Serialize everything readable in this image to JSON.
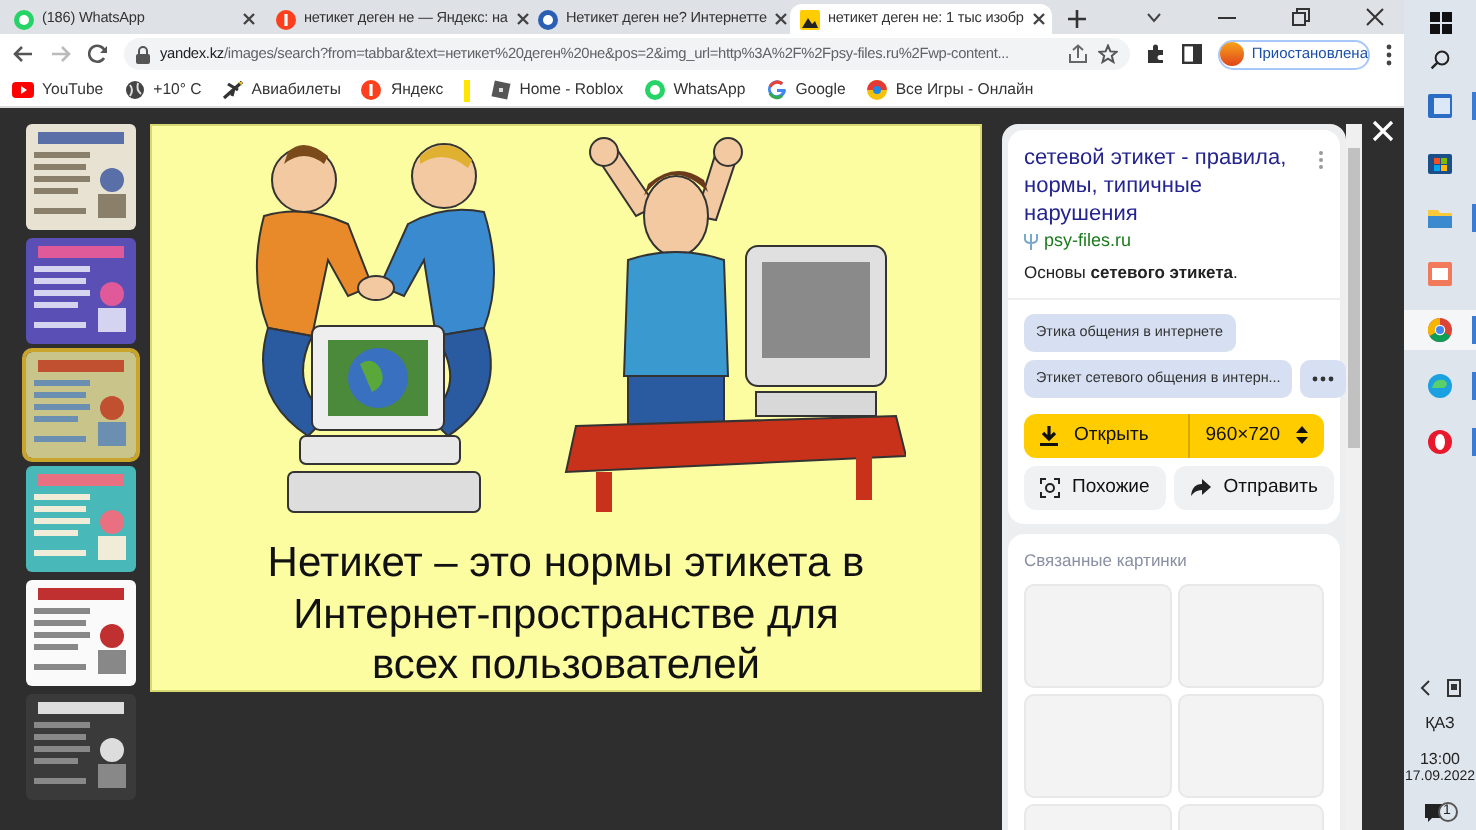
{
  "browser": {
    "tabs": [
      {
        "title": "(186) WhatsApp",
        "selected": false
      },
      {
        "title": "нетикет деген не — Яндекс: на",
        "selected": false
      },
      {
        "title": "Нетикет деген не? Интернетте",
        "selected": false
      },
      {
        "title": "нетикет деген не: 1 тыс изобр",
        "selected": true
      }
    ],
    "address": {
      "host": "yandex.kz",
      "path": "/images/search?from=tabbar&text=нетикет%20деген%20не&pos=2&img_url=http%3A%2F%2Fpsy-files.ru%2Fwp-content..."
    },
    "profile": "Приостановлена",
    "bookmarks": [
      {
        "kind": "link",
        "title": "YouTube"
      },
      {
        "kind": "link",
        "title": "+10° C"
      },
      {
        "kind": "link",
        "title": "Авиабилеты"
      },
      {
        "kind": "link",
        "title": "Яндекс"
      },
      {
        "kind": "marker"
      },
      {
        "kind": "link",
        "title": "Home - Roblox"
      },
      {
        "kind": "link",
        "title": "WhatsApp"
      },
      {
        "kind": "link",
        "title": "Google"
      },
      {
        "kind": "link",
        "title": "Все Игры - Онлайн"
      }
    ]
  },
  "viewer": {
    "thumbnails": [
      {
        "kind": "picture",
        "selected": false
      },
      {
        "kind": "picture",
        "selected": false
      },
      {
        "kind": "picture",
        "selected": true
      },
      {
        "kind": "picture",
        "selected": false
      },
      {
        "kind": "picture",
        "selected": false
      },
      {
        "kind": "picture",
        "selected": false
      }
    ],
    "slide": {
      "caption": "Нетикет – это нормы этикета в Интернет-пространстве для всех пользователей"
    },
    "info": {
      "title": "сетевой этикет - правила, нормы, типичные нарушения",
      "source": "psy-files.ru",
      "description": "Основы **сетевого этикета**.",
      "tags": [
        "Этика общения в интернете",
        "Этикет сетевого общения в интерн..."
      ],
      "open": "Открыть",
      "size": "960×720",
      "similar": "Похожие",
      "share": "Отправить"
    },
    "related": {
      "title": "Связанные картинки"
    }
  },
  "taskbar": {
    "language": "ҚАЗ",
    "time": "13:00",
    "date": "17.09.2022",
    "notifications": "1"
  }
}
